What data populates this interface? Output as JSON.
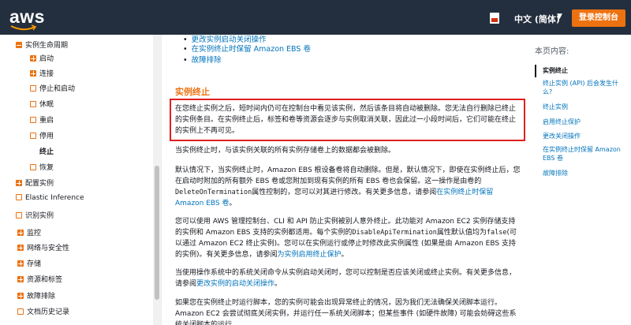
{
  "header": {
    "logo": "aws",
    "language": "中文 (简体)",
    "console_button": "登录控制台"
  },
  "sidebar": {
    "items": [
      {
        "label": "实例生命周期",
        "type": "minus",
        "indent": 1
      },
      {
        "label": "启动",
        "type": "plus",
        "indent": 2
      },
      {
        "label": "连接",
        "type": "plus",
        "indent": 2
      },
      {
        "label": "停止和启动",
        "type": "empty",
        "indent": 2
      },
      {
        "label": "休眠",
        "type": "empty",
        "indent": 2
      },
      {
        "label": "重启",
        "type": "empty",
        "indent": 2
      },
      {
        "label": "停用",
        "type": "empty",
        "indent": 2
      },
      {
        "label": "终止",
        "type": "none",
        "indent": 2
      },
      {
        "label": "恢复",
        "type": "empty",
        "indent": 2
      },
      {
        "label": "配置实例",
        "type": "plus",
        "indent": 1
      },
      {
        "label": "Elastic Inference",
        "type": "empty",
        "indent": 1
      },
      {
        "label": "识别实例",
        "type": "empty",
        "indent": 1
      },
      {
        "label": "监控",
        "type": "plus",
        "indent": 0
      },
      {
        "label": "网络与安全性",
        "type": "plus",
        "indent": 0
      },
      {
        "label": "存储",
        "type": "plus",
        "indent": 0
      },
      {
        "label": "资源和标签",
        "type": "plus",
        "indent": 0
      },
      {
        "label": "故障排除",
        "type": "plus",
        "indent": 0
      },
      {
        "label": "文档历史记录",
        "type": "empty",
        "indent": 0
      }
    ]
  },
  "content": {
    "bullets": [
      "更改实例启动关闭操作",
      "在实例终止时保留 Amazon EBS 卷",
      "故障排除"
    ],
    "section_title": "实例终止",
    "highlight_text": "在您终止实例之后，短时间内仍可在控制台中看见该实例，然后该条目将自动被删除。您无法自行删除已终止的实例条目。在实例终止后，标签和卷等资源会逐步与实例取消关联，因此过一小段时间后，它们可能在终止的实例上不再可见。",
    "p1": "当实例终止时，与该实例关联的所有实例存储卷上的数据都会被删除。",
    "p2_a": "默认情况下，当实例终止时，Amazon EBS 根设备卷将自动删除。但是，默认情况下，即使在实例终止后，您在启动时附加的所有额外 EBS 卷或您附加到现有实例的所有 EBS 卷也会保留。这一操作是由卷的",
    "p2_code": "DeleteOnTermination",
    "p2_b": "属性控制的，您可以对其进行修改。有关更多信息，请参阅",
    "p2_link": "在实例终止时保留 Amazon EBS 卷",
    "p2_end": "。",
    "p3_a": "您可以使用 AWS 管理控制台、CLI 和 API 防止实例被别人意外终止。此功能对 Amazon EC2 实例存储支持的实例和 Amazon EBS 支持的实例都适用。每个实例的",
    "p3_code1": "DisableApiTermination",
    "p3_b": "属性默认值均为",
    "p3_code2": "false",
    "p3_c": "(可以通过 Amazon EC2 终止实例)。您可以在实例运行或停止时修改此实例属性 (如果是由 Amazon EBS 支持的实例)。有关更多信息，请参阅",
    "p3_link": "为实例启用终止保护",
    "p3_end": "。",
    "p4_a": "当使用操作系统中的系统关闭命令从实例启动关闭时，您可以控制是否应该关闭或终止实例。有关更多信息，请参阅",
    "p4_link": "更改实例的启动关闭操作",
    "p4_end": "。",
    "p5": "如果您在实例终止时运行脚本，您的实例可能会出现异常终止的情况，因为我们无法确保关闭脚本运行。Amazon EC2 会尝试彻底关闭实例，并运行任一系统关闭脚本；但某些事件 (如硬件故障) 可能会妨碍这些系统关闭脚本的运行。"
  },
  "toc": {
    "title": "本页内容:",
    "items": [
      "实例终止",
      "终止实例 (API) 后会发生什么?",
      "终止实例",
      "启用终止保护",
      "更改关闭操作",
      "在实例终止时保留 Amazon EBS 卷",
      "故障排除"
    ]
  },
  "colors": {
    "header_bg": "#232f3e",
    "accent": "#ec7211",
    "link": "#0073bb",
    "highlight_border": "#e02020"
  }
}
